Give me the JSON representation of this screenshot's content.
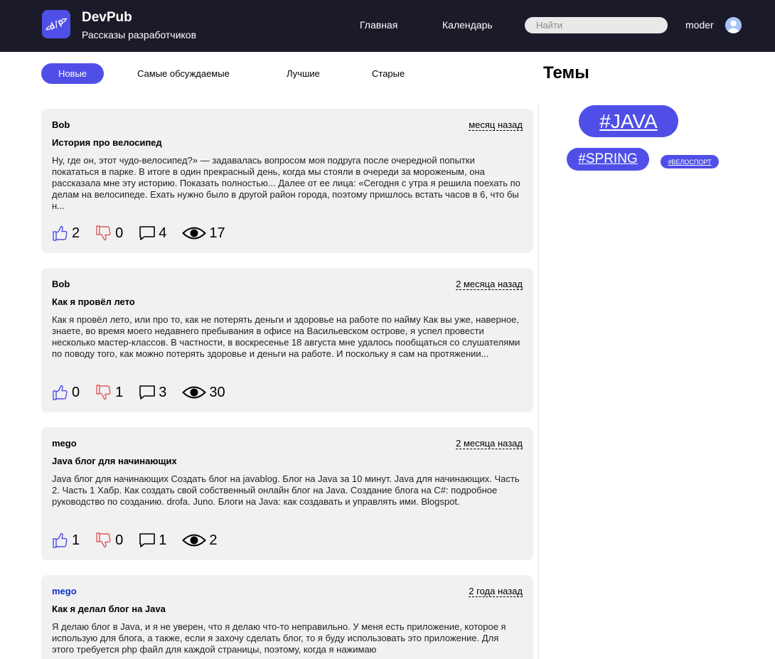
{
  "header": {
    "logo_text": "<d/p>",
    "brand_title": "DevPub",
    "brand_subtitle": "Рассказы разработчиков",
    "nav": [
      {
        "label": "Главная"
      },
      {
        "label": "Календарь"
      }
    ],
    "search_placeholder": "Найти",
    "username": "moder"
  },
  "tabs": [
    {
      "label": "Новые",
      "active": true
    },
    {
      "label": "Самые обсуждаемые",
      "active": false
    },
    {
      "label": "Лучшие",
      "active": false
    },
    {
      "label": "Старые",
      "active": false
    }
  ],
  "topics": {
    "title": "Темы",
    "tags": [
      {
        "label": "#JAVA"
      },
      {
        "label": "#SPRING"
      },
      {
        "label": "#ВЕЛОСПОРТ"
      }
    ]
  },
  "posts": [
    {
      "author": "Bob",
      "date": "месяц назад",
      "title": "История про велосипед",
      "text": "Ну, где он, этот чудо-велосипед?» — задавалась вопросом моя подруга после очередной попытки покататься в парке. В итоге в один прекрасный день, когда мы стояли в очереди за мороженым, она рассказала мне эту историю. Показать полностью... Далее от ее лица: «Сегодня с утра я решила поехать по делам на велосипеде. Ехать нужно было в другой район города, поэтому пришлось встать часов в 6, что бы н...",
      "likes": "2",
      "dislikes": "0",
      "comments": "4",
      "views": "17"
    },
    {
      "author": "Bob",
      "date": "2 месяца назад",
      "title": "Как я провёл лето",
      "text": "Как я провёл лето, или про то, как не потерять деньги и здоровье на работе по найму Как вы уже, наверное, знаете, во время моего недавнего пребывания в офисе на Васильевском острове, я успел провести несколько мастер-классов. В частности, в воскресенье 18 августа мне удалось пообщаться со слушателями по поводу того, как можно потерять здоровье и деньги на работе. И поскольку я сам на протяжении...",
      "likes": "0",
      "dislikes": "1",
      "comments": "3",
      "views": "30"
    },
    {
      "author": "mego",
      "date": "2 месяца назад",
      "title": "Java блог для начинающих",
      "text": "Java блог для начинающих Создать блог на javablog. Блог на Java за 10 минут. Java для начинающих. Часть 2. Часть 1 Хабр. Как создать свой собственный онлайн блог на Java. Создание блога на C#: подробное руководство по созданию. drofa. Juno. Блоги на Java: как создавать и управлять ими. Blogspot.",
      "likes": "1",
      "dislikes": "0",
      "comments": "1",
      "views": "2"
    },
    {
      "author": "mego",
      "date": "2 года назад",
      "title": "Как я делал блог на Java",
      "text": "Я делаю блог в Java, и я не уверен, что я делаю что-то неправильно. У меня есть приложение, которое я использую для блога, а также, если я захочу сделать блог, то я буду использовать это приложение. Для этого требуется php файл для каждой страницы, поэтому, когда я нажимаю",
      "likes": "",
      "dislikes": "",
      "comments": "",
      "views": ""
    }
  ],
  "colors": {
    "header_bg": "#1a1a29",
    "accent": "#4f4fe8",
    "card_bg": "#f1f1f1",
    "like": "#4f4fe8",
    "dislike": "#e05a5a"
  },
  "icons": [
    "logo-icon",
    "avatar-icon",
    "like-icon",
    "dislike-icon",
    "comment-icon",
    "views-icon"
  ]
}
